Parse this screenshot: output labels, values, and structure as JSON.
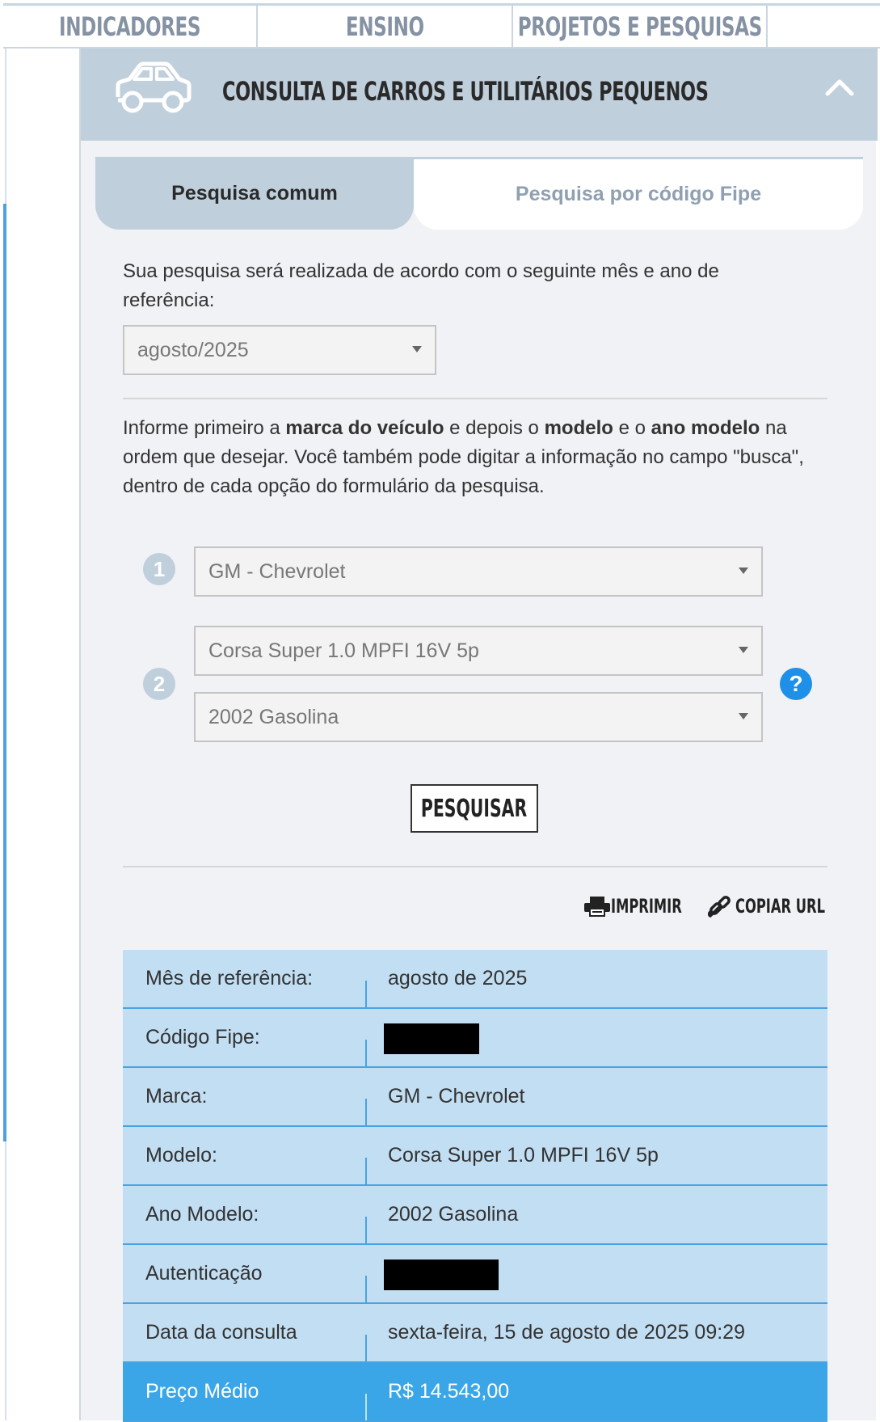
{
  "nav": {
    "items": [
      "INDICADORES",
      "ENSINO",
      "PROJETOS E PESQUISAS"
    ]
  },
  "panel": {
    "title": "CONSULTA DE CARROS E UTILITÁRIOS PEQUENOS",
    "icon": "car-icon",
    "collapse_icon": "chevron-up-icon"
  },
  "tabs": {
    "common": "Pesquisa comum",
    "fipe": "Pesquisa por código Fipe"
  },
  "reference": {
    "text": "Sua pesquisa será realizada de acordo com o seguinte mês e ano de referência:",
    "selected": "agosto/2025"
  },
  "instructions": {
    "p1": "Informe primeiro a ",
    "b1": "marca do veículo",
    "p2": " e depois o ",
    "b2": "modelo",
    "p3": " e o ",
    "b3": "ano modelo",
    "p4": " na ordem que desejar. Você também pode digitar a informação no campo \"busca\", dentro de cada opção do formulário da pesquisa."
  },
  "form": {
    "step1": "1",
    "step2": "2",
    "brand": "GM - Chevrolet",
    "model": "Corsa Super 1.0 MPFI 16V 5p",
    "year": "2002 Gasolina",
    "help": "?",
    "search_label": "PESQUISAR"
  },
  "actions": {
    "print": "IMPRIMIR",
    "copy_url": "COPIAR URL"
  },
  "results": {
    "rows": [
      {
        "label": "Mês de referência:",
        "value": "agosto de 2025"
      },
      {
        "label": "Código Fipe:",
        "value": ""
      },
      {
        "label": "Marca:",
        "value": "GM - Chevrolet"
      },
      {
        "label": "Modelo:",
        "value": "Corsa Super 1.0 MPFI 16V 5p"
      },
      {
        "label": "Ano Modelo:",
        "value": "2002 Gasolina"
      },
      {
        "label": "Autenticação",
        "value": ""
      },
      {
        "label": "Data da consulta",
        "value": "sexta-feira, 15 de agosto de 2025 09:29"
      },
      {
        "label": "Preço Médio",
        "value": "R$ 14.543,00"
      }
    ]
  },
  "colors": {
    "header_bg": "#c0cfdc",
    "row_bg": "#c2def3",
    "accent": "#3aa6e8",
    "help": "#1e90e8"
  }
}
